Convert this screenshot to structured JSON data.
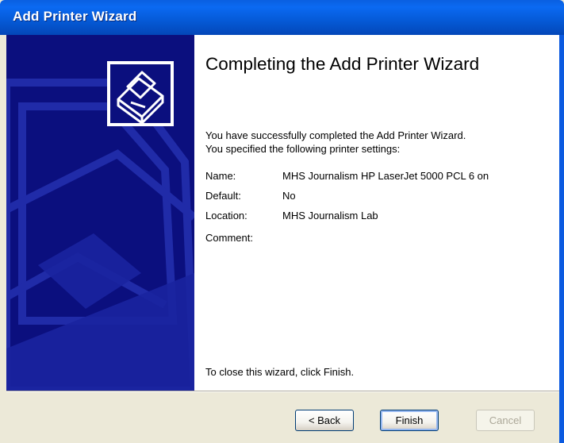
{
  "window": {
    "title": "Add Printer Wizard"
  },
  "heading": "Completing the Add Printer Wizard",
  "intro": {
    "line1": "You have successfully completed the Add Printer Wizard.",
    "line2": "You specified the following printer settings:"
  },
  "settings": [
    {
      "label": "Name:",
      "value": "MHS Journalism HP LaserJet 5000 PCL 6 on"
    },
    {
      "label": "Default:",
      "value": "No"
    },
    {
      "label": "Location:",
      "value": "MHS Journalism Lab"
    },
    {
      "label": "Comment:",
      "value": ""
    }
  ],
  "footer_text": "To close this wizard, click Finish.",
  "buttons": {
    "back": "< Back",
    "finish": "Finish",
    "cancel": "Cancel"
  },
  "colors": {
    "title_bar": "#0b5ae0",
    "side_panel": "#0b0f7e",
    "dialog_bg": "#ece9d8"
  },
  "icons": {
    "wizard": "printer-icon"
  }
}
